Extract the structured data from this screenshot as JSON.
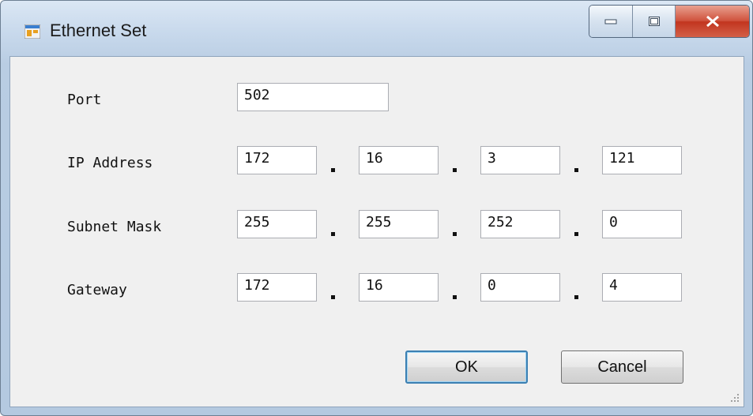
{
  "window": {
    "title": "Ethernet Set"
  },
  "form": {
    "port_label": "Port",
    "port_value": "502",
    "ip_label": "IP Address",
    "ip": [
      "172",
      "16",
      "3",
      "121"
    ],
    "subnet_label": "Subnet Mask",
    "subnet": [
      "255",
      "255",
      "252",
      "0"
    ],
    "gateway_label": "Gateway",
    "gateway": [
      "172",
      "16",
      "0",
      "4"
    ]
  },
  "buttons": {
    "ok": "OK",
    "cancel": "Cancel"
  },
  "icons": [
    "app-icon",
    "minimize-icon",
    "maximize-icon",
    "close-icon",
    "resize-grip-icon"
  ]
}
